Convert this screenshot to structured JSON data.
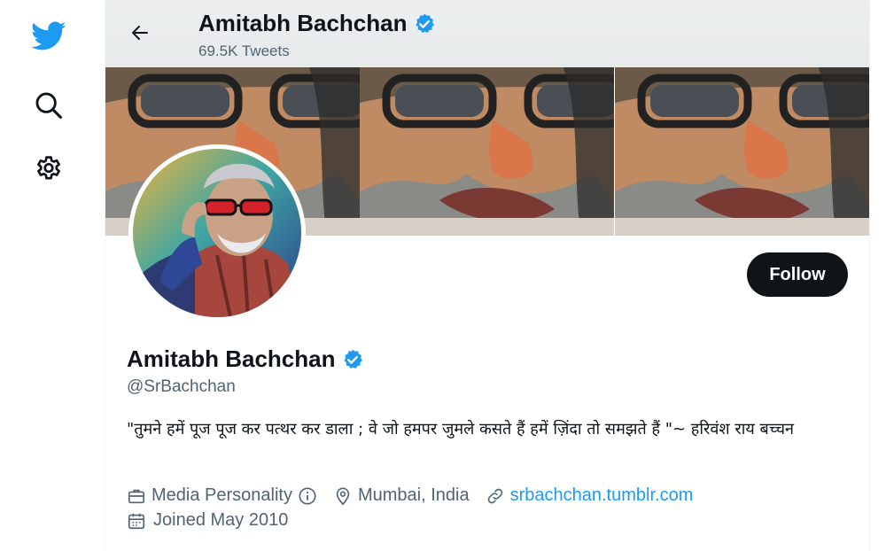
{
  "profile": {
    "name": "Amitabh Bachchan",
    "tweet_count": "69.5K Tweets",
    "handle": "@SrBachchan",
    "bio": "\"तुमने हमें पूज पूज कर पत्थर कर डाला ; वे जो हमपर जुमले कसते हैं हमें ज़िंदा तो समझते हैं \"~ हरिवंश राय  बच्चन",
    "category": "Media Personality",
    "location": "Mumbai, India",
    "website": "srbachchan.tumblr.com",
    "joined": "Joined May 2010",
    "verified": true
  },
  "actions": {
    "follow_label": "Follow"
  },
  "colors": {
    "accent": "#1d9bf0",
    "button_bg": "#0f1419",
    "muted_text": "#536471"
  },
  "nav_icons": [
    "twitter-logo-icon",
    "search-icon",
    "settings-icon"
  ]
}
